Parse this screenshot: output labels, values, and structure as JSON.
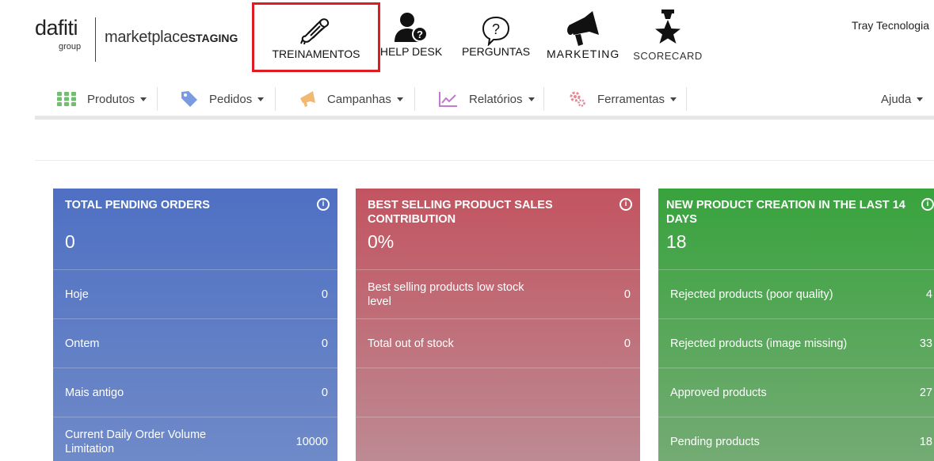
{
  "brand": {
    "name": "dafiti",
    "sub": "group",
    "marketplace": "marketplace",
    "env": "STAGING"
  },
  "topnav": [
    {
      "label": "TREINAMENTOS",
      "icon": "diploma-icon"
    },
    {
      "label": "HELP DESK",
      "icon": "user-help-icon"
    },
    {
      "label": "PERGUNTAS",
      "icon": "question-bubble-icon"
    },
    {
      "label": "MARKETING",
      "icon": "megaphone-icon"
    },
    {
      "label": "SCORECARD",
      "icon": "medal-star-icon"
    }
  ],
  "user": {
    "name": "Tray Tecnologia"
  },
  "menu": [
    {
      "label": "Produtos",
      "icon": "grid-icon",
      "color": "#6fbf6f"
    },
    {
      "label": "Pedidos",
      "icon": "tag-icon",
      "color": "#7a9be0"
    },
    {
      "label": "Campanhas",
      "icon": "megaphone-icon",
      "color": "#f0b870"
    },
    {
      "label": "Relatórios",
      "icon": "chart-icon",
      "color": "#c07ad0"
    },
    {
      "label": "Ferramentas",
      "icon": "gear-icon",
      "color": "#e08a96"
    },
    {
      "label": "Ajuda"
    }
  ],
  "cards": [
    {
      "title": "TOTAL PENDING ORDERS",
      "value": "0",
      "color": "#4f70c3",
      "rows": [
        {
          "label": "Hoje",
          "value": "0"
        },
        {
          "label": "Ontem",
          "value": "0"
        },
        {
          "label": "Mais antigo",
          "value": "0"
        },
        {
          "label": "Current Daily Order Volume Limitation",
          "value": "10000"
        }
      ]
    },
    {
      "title": "BEST SELLING PRODUCT SALES CONTRIBUTION",
      "value": "0%",
      "color": "#c25460",
      "rows": [
        {
          "label": "Best selling products low stock level",
          "value": "0"
        },
        {
          "label": "Total out of stock",
          "value": "0"
        },
        {
          "label": "",
          "value": ""
        },
        {
          "label": "",
          "value": ""
        }
      ]
    },
    {
      "title": "NEW PRODUCT CREATION IN THE LAST 14 DAYS",
      "value": "18",
      "color": "#38a33d",
      "rows": [
        {
          "label": "Rejected products (poor quality)",
          "value": "4"
        },
        {
          "label": "Rejected products (image missing)",
          "value": "33"
        },
        {
          "label": "Approved products",
          "value": "27"
        },
        {
          "label": "Pending products",
          "value": "18"
        }
      ]
    }
  ]
}
